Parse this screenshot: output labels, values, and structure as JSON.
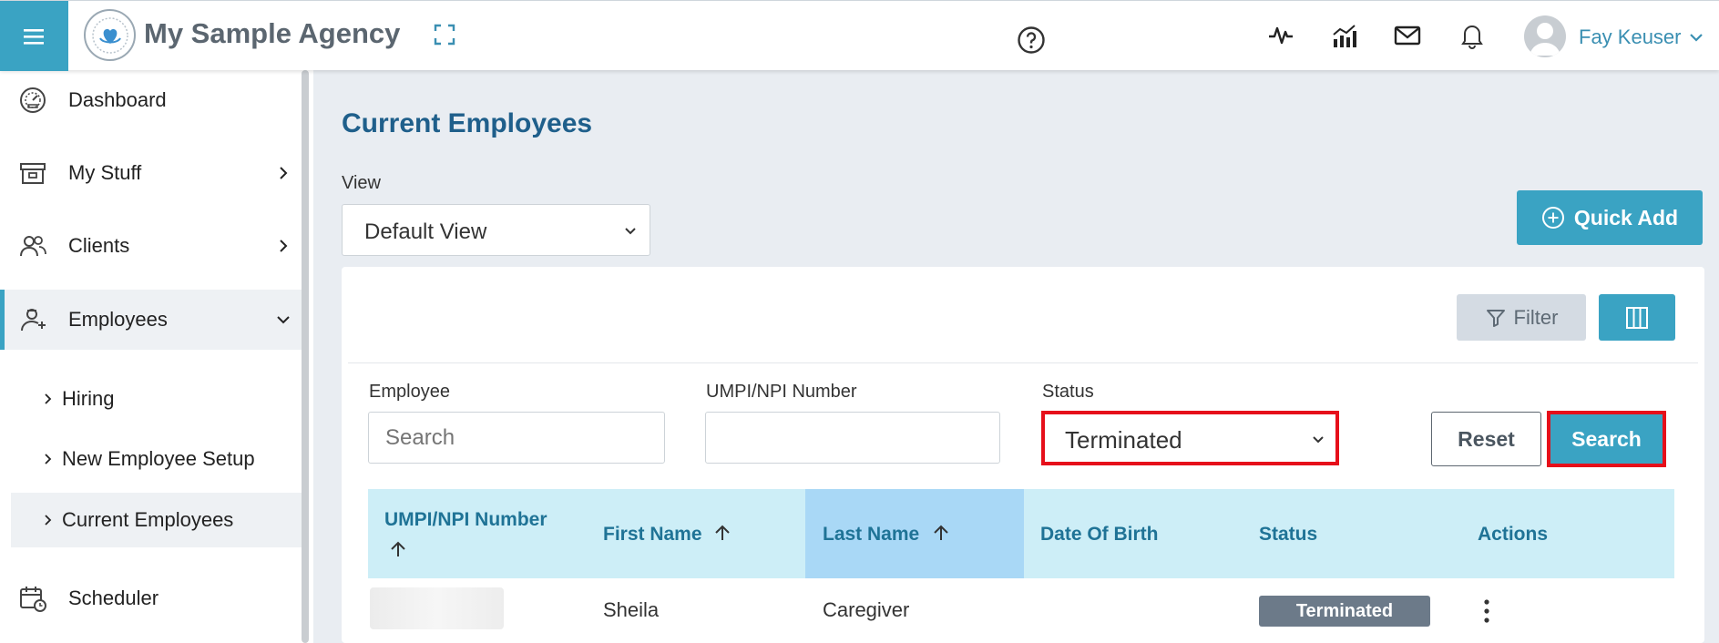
{
  "header": {
    "agency_name": "My Sample Agency",
    "user_name": "Fay Keuser",
    "icons": [
      "menu-icon",
      "agency-logo",
      "fullscreen-icon",
      "help-icon",
      "activity-icon",
      "analytics-icon",
      "mail-icon",
      "bell-icon",
      "user-avatar",
      "chevron-down-icon"
    ]
  },
  "sidebar": {
    "items": [
      {
        "label": "Dashboard",
        "icon": "dashboard-icon"
      },
      {
        "label": "My Stuff",
        "icon": "archive-icon"
      },
      {
        "label": "Clients",
        "icon": "clients-icon"
      },
      {
        "label": "Employees",
        "icon": "employee-icon",
        "expanded": true
      },
      {
        "label": "Scheduler",
        "icon": "calendar-clock-icon"
      }
    ],
    "sub_items": [
      {
        "label": "Hiring"
      },
      {
        "label": "New Employee Setup"
      },
      {
        "label": "Current Employees",
        "active": true
      }
    ]
  },
  "main": {
    "title": "Current Employees",
    "view_label": "View",
    "view_value": "Default View",
    "quick_add_label": "Quick Add",
    "filter_label": "Filter",
    "filters": {
      "employee_label": "Employee",
      "employee_placeholder": "Search",
      "umpi_label": "UMPI/NPI Number",
      "umpi_value": "",
      "status_label": "Status",
      "status_value": "Terminated"
    },
    "reset_label": "Reset",
    "search_label": "Search",
    "table": {
      "columns": [
        "UMPI/NPI Number",
        "First Name",
        "Last Name",
        "Date Of Birth",
        "Status",
        "Actions"
      ],
      "rows": [
        {
          "umpi": "",
          "first_name": "Sheila",
          "last_name": "Caregiver",
          "dob": "",
          "status": "Terminated"
        }
      ]
    }
  },
  "colors": {
    "accent": "#3aa3c3",
    "highlight_outline": "#e60f1a",
    "title": "#1f5f8b",
    "badge": "#6c7a89"
  }
}
